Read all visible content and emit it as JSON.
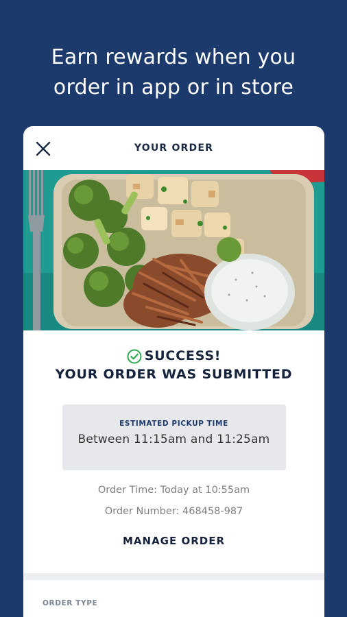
{
  "promo": {
    "headline_line1": "Earn rewards when you",
    "headline_line2": "order in app or in store"
  },
  "card": {
    "title": "YOUR ORDER",
    "close_icon": "close-icon"
  },
  "confirmation": {
    "status": "SUCCESS!",
    "message": "YOUR ORDER WAS SUBMITTED",
    "status_icon": "check-circle-icon",
    "status_color": "#2fa84f"
  },
  "pickup": {
    "label": "ESTIMATED PICKUP TIME",
    "value": "Between 11:15am and 11:25am"
  },
  "order": {
    "time_text": "Order Time: Today at 10:55am",
    "number_text": "Order Number: 468458-987",
    "manage_label": "MANAGE ORDER"
  },
  "details": {
    "order_type_label": "ORDER TYPE"
  },
  "colors": {
    "background": "#1d3a6c",
    "accent_navy": "#1d3a6c",
    "text_dark": "#16233d",
    "muted": "#808080"
  }
}
